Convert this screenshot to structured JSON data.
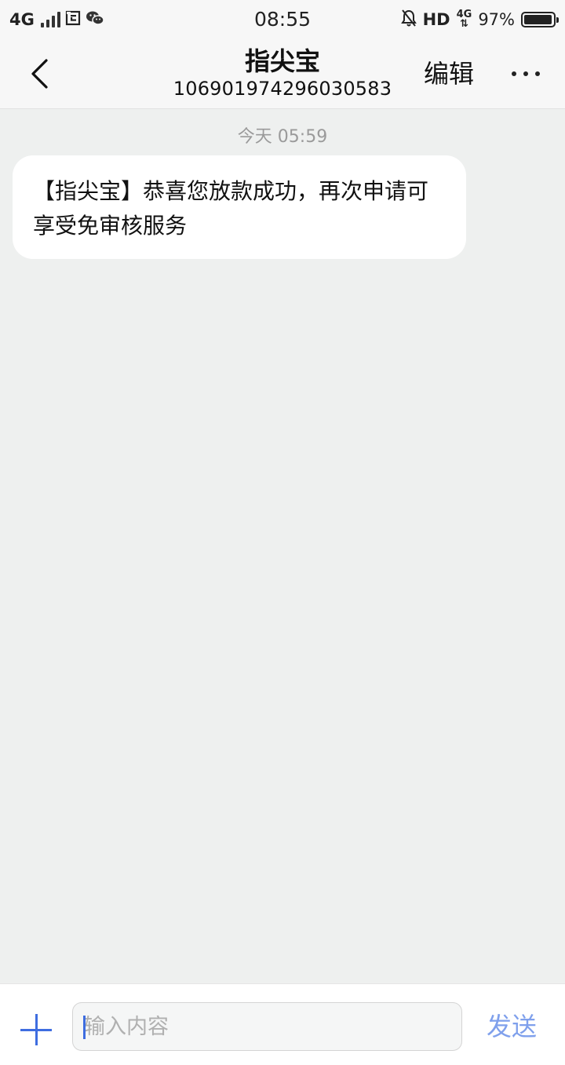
{
  "status_bar": {
    "network": "4G",
    "time": "08:55",
    "hd": "HD",
    "network_right": "4G",
    "battery": "97%",
    "battery_level": 0.97
  },
  "header": {
    "title": "指尖宝",
    "sender_number": "106901974296030583",
    "edit_label": "编辑"
  },
  "conversation": {
    "timestamp": "今天 05:59",
    "messages": [
      {
        "text": "【指尖宝】恭喜您放款成功，再次申请可享受免审核服务"
      }
    ]
  },
  "composer": {
    "placeholder": "输入内容",
    "send_label": "发送"
  }
}
